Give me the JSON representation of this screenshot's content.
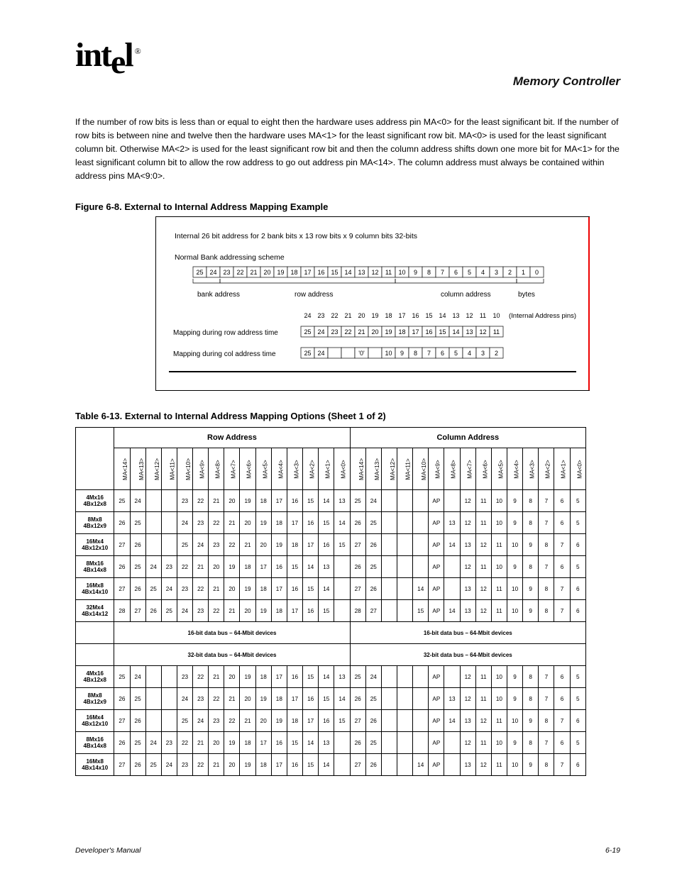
{
  "logo": {
    "text": "intel",
    "reg": "®"
  },
  "chapter": "Memory Controller",
  "paragraph": "If the number of row bits is less than or equal to eight then the hardware uses address pin MA<0> for the least significant bit. If the number of row bits is between nine and twelve then the hardware uses MA<1> for the least significant row bit. MA<0> is used for the least significant column bit. Otherwise MA<2> is used for the least significant row bit and then the column address shifts down one more bit for MA<1> for the least significant column bit to allow the row address to go out address pin MA<14>. The column address must always be contained within address pins MA<9:0>.",
  "figure": {
    "caption_prefix": "Figure 6-8.",
    "caption": "External to Internal Address Mapping Example",
    "title": "Internal 26 bit address for 2 bank bits x 13 row bits x 9 column bits 32-bits",
    "subtitle": "Normal Bank addressing scheme",
    "bits": [
      "25",
      "24",
      "23",
      "22",
      "21",
      "20",
      "19",
      "18",
      "17",
      "16",
      "15",
      "14",
      "13",
      "12",
      "11",
      "10",
      "9",
      "8",
      "7",
      "6",
      "5",
      "4",
      "3",
      "2",
      "1",
      "0"
    ],
    "labels": {
      "bank": "bank\naddress",
      "row": "row\naddress",
      "column": "column\naddress",
      "bytes": "bytes",
      "pins_note": "(Internal Address pins)"
    },
    "pin_numbers": [
      "24",
      "23",
      "22",
      "21",
      "20",
      "19",
      "18",
      "17",
      "16",
      "15",
      "14",
      "13",
      "12",
      "11",
      "10"
    ],
    "row_map_label": "Mapping during row address time",
    "row_map": [
      "25",
      "24",
      "23",
      "22",
      "21",
      "20",
      "19",
      "18",
      "17",
      "16",
      "15",
      "14",
      "13",
      "12",
      "11"
    ],
    "col_map_label": "Mapping during col address time",
    "col_map": [
      "25",
      "24",
      "",
      "",
      "'0'",
      "",
      "10",
      "9",
      "8",
      "7",
      "6",
      "5",
      "4",
      "3",
      "2"
    ]
  },
  "table": {
    "caption_prefix": "Table 6-13.",
    "caption": "External to Internal Address Mapping Options (Sheet 1 of 2)",
    "group_a": "Row Address",
    "group_b": "Column Address",
    "col_headers": [
      "MA<14>",
      "MA<13>",
      "MA<12>",
      "MA<11>",
      "MA<10>",
      "MA<9>",
      "MA<8>",
      "MA<7>",
      "MA<6>",
      "MA<5>",
      "MA<4>",
      "MA<3>",
      "MA<2>",
      "MA<1>",
      "MA<0>"
    ],
    "sub16": "16-bit data bus – 64-Mbit devices",
    "sub32": "32-bit data bus – 64-Mbit devices",
    "rows16": [
      {
        "label": "4Mx16 4Bx12x8",
        "row": [
          "25",
          "24",
          "",
          "",
          "23",
          "22",
          "21",
          "20",
          "19",
          "18",
          "17",
          "16",
          "15",
          "14",
          "13"
        ],
        "col": [
          "25",
          "24",
          "",
          "",
          "",
          "AP",
          "",
          "12",
          "11",
          "10",
          "9",
          "8",
          "7",
          "6",
          "5"
        ]
      },
      {
        "label": "8Mx8 4Bx12x9",
        "row": [
          "26",
          "25",
          "",
          "",
          "24",
          "23",
          "22",
          "21",
          "20",
          "19",
          "18",
          "17",
          "16",
          "15",
          "14"
        ],
        "col": [
          "26",
          "25",
          "",
          "",
          "",
          "AP",
          "13",
          "12",
          "11",
          "10",
          "9",
          "8",
          "7",
          "6",
          "5"
        ]
      },
      {
        "label": "16Mx4 4Bx12x10",
        "row": [
          "27",
          "26",
          "",
          "",
          "25",
          "24",
          "23",
          "22",
          "21",
          "20",
          "19",
          "18",
          "17",
          "16",
          "15"
        ],
        "col": [
          "27",
          "26",
          "",
          "",
          "",
          "AP",
          "14",
          "13",
          "12",
          "11",
          "10",
          "9",
          "8",
          "7",
          "6"
        ]
      },
      {
        "label": "8Mx16 4Bx14x8",
        "row": [
          "26",
          "25",
          "24",
          "23",
          "22",
          "21",
          "20",
          "19",
          "18",
          "17",
          "16",
          "15",
          "14",
          "13",
          ""
        ],
        "col": [
          "26",
          "25",
          "",
          "",
          "",
          "AP",
          "",
          "12",
          "11",
          "10",
          "9",
          "8",
          "7",
          "6",
          "5"
        ]
      },
      {
        "label": "16Mx8 4Bx14x10",
        "row": [
          "27",
          "26",
          "25",
          "24",
          "23",
          "22",
          "21",
          "20",
          "19",
          "18",
          "17",
          "16",
          "15",
          "14",
          ""
        ],
        "col": [
          "27",
          "26",
          "",
          "",
          "14",
          "AP",
          "",
          "13",
          "12",
          "11",
          "10",
          "9",
          "8",
          "7",
          "6"
        ]
      },
      {
        "label": "32Mx4 4Bx14x12",
        "row": [
          "28",
          "27",
          "26",
          "25",
          "24",
          "23",
          "22",
          "21",
          "20",
          "19",
          "18",
          "17",
          "16",
          "15",
          ""
        ],
        "col": [
          "28",
          "27",
          "",
          "",
          "15",
          "AP",
          "14",
          "13",
          "12",
          "11",
          "10",
          "9",
          "8",
          "7",
          "6"
        ]
      }
    ],
    "rows32": [
      {
        "label": "4Mx16 4Bx12x8",
        "row": [
          "25",
          "24",
          "",
          "",
          "23",
          "22",
          "21",
          "20",
          "19",
          "18",
          "17",
          "16",
          "15",
          "14",
          "13"
        ],
        "col": [
          "25",
          "24",
          "",
          "",
          "",
          "AP",
          "",
          "12",
          "11",
          "10",
          "9",
          "8",
          "7",
          "6",
          "5"
        ]
      },
      {
        "label": "8Mx8 4Bx12x9",
        "row": [
          "26",
          "25",
          "",
          "",
          "24",
          "23",
          "22",
          "21",
          "20",
          "19",
          "18",
          "17",
          "16",
          "15",
          "14"
        ],
        "col": [
          "26",
          "25",
          "",
          "",
          "",
          "AP",
          "13",
          "12",
          "11",
          "10",
          "9",
          "8",
          "7",
          "6",
          "5"
        ]
      },
      {
        "label": "16Mx4 4Bx12x10",
        "row": [
          "27",
          "26",
          "",
          "",
          "25",
          "24",
          "23",
          "22",
          "21",
          "20",
          "19",
          "18",
          "17",
          "16",
          "15"
        ],
        "col": [
          "27",
          "26",
          "",
          "",
          "",
          "AP",
          "14",
          "13",
          "12",
          "11",
          "10",
          "9",
          "8",
          "7",
          "6"
        ]
      },
      {
        "label": "8Mx16 4Bx14x8",
        "row": [
          "26",
          "25",
          "24",
          "23",
          "22",
          "21",
          "20",
          "19",
          "18",
          "17",
          "16",
          "15",
          "14",
          "13",
          ""
        ],
        "col": [
          "26",
          "25",
          "",
          "",
          "",
          "AP",
          "",
          "12",
          "11",
          "10",
          "9",
          "8",
          "7",
          "6",
          "5"
        ]
      },
      {
        "label": "16Mx8 4Bx14x10",
        "row": [
          "27",
          "26",
          "25",
          "24",
          "23",
          "22",
          "21",
          "20",
          "19",
          "18",
          "17",
          "16",
          "15",
          "14",
          ""
        ],
        "col": [
          "27",
          "26",
          "",
          "",
          "14",
          "AP",
          "",
          "13",
          "12",
          "11",
          "10",
          "9",
          "8",
          "7",
          "6"
        ]
      }
    ]
  },
  "footer": {
    "left": "Developer's Manual",
    "right": "6-19"
  }
}
